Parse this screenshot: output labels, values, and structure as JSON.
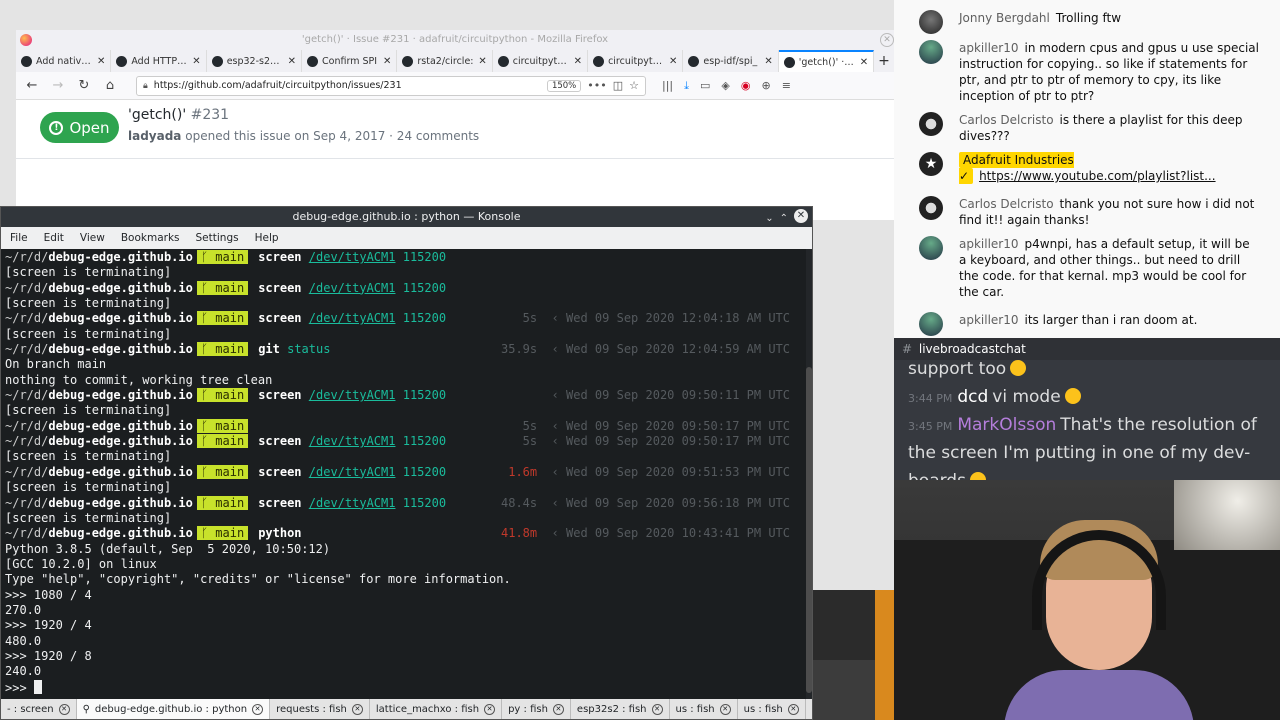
{
  "firefox": {
    "window_title": "'getch()' · Issue #231 · adafruit/circuitpython - Mozilla Firefox",
    "tabs": [
      {
        "title": "Add native w"
      },
      {
        "title": "Add HTTP/1.1"
      },
      {
        "title": "esp32-s2_datas"
      },
      {
        "title": "Confirm SPI"
      },
      {
        "title": "rsta2/circle:"
      },
      {
        "title": "circuitpython"
      },
      {
        "title": "circuitpython"
      },
      {
        "title": "esp-idf/spi_"
      },
      {
        "title": "'getch()' · Iss"
      }
    ],
    "url": "https://github.com/adafruit/circuitpython/issues/231",
    "zoom": "150%",
    "issue": {
      "state": "Open",
      "title": "'getch()'",
      "number": "#231",
      "author": "ladyada",
      "meta_rest": "opened this issue on Sep 4, 2017 · 24 comments"
    }
  },
  "konsole": {
    "title": "debug-edge.github.io : python — Konsole",
    "menu": [
      "File",
      "Edit",
      "View",
      "Bookmarks",
      "Settings",
      "Help"
    ],
    "prompt": {
      "path": "~/r/d/",
      "host": "debug-edge.github.io",
      "branch": "ᚴ main"
    },
    "lines": [
      {
        "type": "prompt",
        "cmd": "screen",
        "arg": "/dev/ttyACM1",
        "arg2": "115200",
        "dur": "",
        "time": ""
      },
      {
        "type": "out",
        "text": "[screen is terminating]"
      },
      {
        "type": "prompt",
        "cmd": "screen",
        "arg": "/dev/ttyACM1",
        "arg2": "115200",
        "dur": "",
        "time": ""
      },
      {
        "type": "out",
        "text": "[screen is terminating]"
      },
      {
        "type": "prompt",
        "cmd": "screen",
        "arg": "/dev/ttyACM1",
        "arg2": "115200",
        "dur": "5s",
        "time": "Wed 09 Sep 2020 12:04:18 AM UTC"
      },
      {
        "type": "out",
        "text": "[screen is terminating]"
      },
      {
        "type": "prompt",
        "cmd": "git",
        "arg": "",
        "arg2": "status",
        "dur": "35.9s",
        "time": "Wed 09 Sep 2020 12:04:59 AM UTC"
      },
      {
        "type": "out",
        "text": "On branch main"
      },
      {
        "type": "out",
        "text": "nothing to commit, working tree clean"
      },
      {
        "type": "prompt",
        "cmd": "screen",
        "arg": "/dev/ttyACM1",
        "arg2": "115200",
        "dur": "",
        "time": "Wed 09 Sep 2020 09:50:11 PM UTC"
      },
      {
        "type": "out",
        "text": "[screen is terminating]"
      },
      {
        "type": "prompt",
        "cmd": "",
        "arg": "",
        "arg2": "",
        "dur": "5s",
        "time": "Wed 09 Sep 2020 09:50:17 PM UTC"
      },
      {
        "type": "prompt",
        "cmd": "screen",
        "arg": "/dev/ttyACM1",
        "arg2": "115200",
        "dur": "5s",
        "time": "Wed 09 Sep 2020 09:50:17 PM UTC"
      },
      {
        "type": "out",
        "text": "[screen is terminating]"
      },
      {
        "type": "prompt",
        "cmd": "screen",
        "arg": "/dev/ttyACM1",
        "arg2": "115200",
        "dur": "1.6m",
        "dur_red": true,
        "time": "Wed 09 Sep 2020 09:51:53 PM UTC"
      },
      {
        "type": "out",
        "text": "[screen is terminating]"
      },
      {
        "type": "prompt",
        "cmd": "screen",
        "arg": "/dev/ttyACM1",
        "arg2": "115200",
        "dur": "48.4s",
        "time": "Wed 09 Sep 2020 09:56:18 PM UTC"
      },
      {
        "type": "out",
        "text": "[screen is terminating]"
      },
      {
        "type": "prompt",
        "cmd": "python",
        "arg": "",
        "arg2": "",
        "dur": "41.8m",
        "dur_red": true,
        "time": "Wed 09 Sep 2020 10:43:41 PM UTC"
      },
      {
        "type": "out",
        "text": "Python 3.8.5 (default, Sep  5 2020, 10:50:12)"
      },
      {
        "type": "out",
        "text": "[GCC 10.2.0] on linux"
      },
      {
        "type": "out",
        "text": "Type \"help\", \"copyright\", \"credits\" or \"license\" for more information."
      },
      {
        "type": "out",
        "text": ">>> 1080 / 4"
      },
      {
        "type": "out",
        "text": "270.0"
      },
      {
        "type": "out",
        "text": ">>> 1920 / 4"
      },
      {
        "type": "out",
        "text": "480.0"
      },
      {
        "type": "out",
        "text": ">>> 1920 / 8"
      },
      {
        "type": "out",
        "text": "240.0"
      },
      {
        "type": "cursor",
        "text": ">>> "
      }
    ],
    "tabs": [
      {
        "title": "- : screen",
        "active": false
      },
      {
        "title": "debug-edge.github.io : python",
        "active": true
      },
      {
        "title": "requests : fish",
        "active": false
      },
      {
        "title": "lattice_machxo : fish",
        "active": false
      },
      {
        "title": "py : fish",
        "active": false
      },
      {
        "title": "esp32s2 : fish",
        "active": false
      },
      {
        "title": "us : fish",
        "active": false
      },
      {
        "title": "us : fish",
        "active": false
      }
    ]
  },
  "youtube_chat": {
    "messages": [
      {
        "author": "Jonny Bergdahl",
        "text": "Trolling ftw",
        "avatar": "jb"
      },
      {
        "author": "apkiller10",
        "text": "in modern cpus and gpus u use special instruction for copying.. so like if statements for ptr, and ptr to ptr of memory to cpy, its like inception of ptr to ptr?",
        "avatar": "ap"
      },
      {
        "author": "Carlos Delcristo",
        "text": "is there a playlist for this deep dives???",
        "avatar": "cd"
      },
      {
        "author": "Adafruit Industries ✓",
        "text": "https://www.youtube.com/playlist?list...",
        "avatar": "ai",
        "owner": true
      },
      {
        "author": "Carlos Delcristo",
        "text": "thank you not sure how i did not find it!! again thanks!",
        "avatar": "cd"
      },
      {
        "author": "apkiller10",
        "text": "p4wnpi, has a default setup, it will be a keyboard, and other things.. but need to drill the code. for that kernal. mp3 would be cool for the car.",
        "avatar": "ap"
      },
      {
        "author": "apkiller10",
        "text": "its larger than i ran doom at.",
        "avatar": "ap"
      }
    ]
  },
  "discord": {
    "channel": "livebroadcastchat",
    "lines": [
      {
        "time": "",
        "user": "",
        "text": "support too"
      },
      {
        "time": "3:44 PM",
        "user": "dcd",
        "text": "vi mode"
      },
      {
        "time": "3:45 PM",
        "user": "MarkOlsson",
        "text": "That's the resolution of"
      },
      {
        "time": "",
        "user": "",
        "text": "the screen I'm putting in one of my dev-"
      },
      {
        "time": "",
        "user": "",
        "text": "boards"
      }
    ]
  },
  "colors": {
    "github_open": "#2ea44f",
    "branch_badge": "#c8e22b",
    "konsole_bg": "#1b1e20",
    "teal_arg": "#1abc9c",
    "yt_owner": "#ffd600",
    "discord_bg": "#36393f",
    "discord_purple": "#b57edc"
  }
}
